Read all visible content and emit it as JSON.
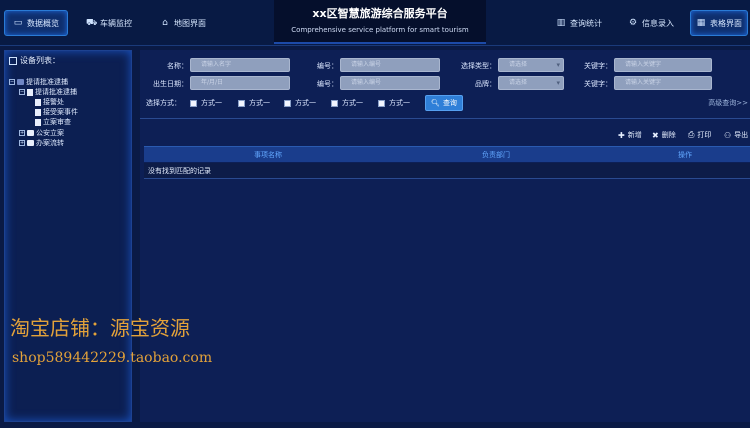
{
  "header": {
    "title": "xx区智慧旅游综合服务平台",
    "subtitle": "Comprehensive service platform for smart tourism",
    "nav_left": [
      {
        "label": "数据概览",
        "icon": "monitor-icon",
        "active": true
      },
      {
        "label": "车辆监控",
        "icon": "truck-icon",
        "active": false
      },
      {
        "label": "地图界面",
        "icon": "home-icon",
        "active": false
      }
    ],
    "nav_right": [
      {
        "label": "查询统计",
        "icon": "bar-chart-icon",
        "active": false
      },
      {
        "label": "信息录入",
        "icon": "gear-icon",
        "active": false
      },
      {
        "label": "表格界面",
        "icon": "table-icon",
        "active": true
      }
    ]
  },
  "sidebar": {
    "title": "设备列表：",
    "tree": [
      {
        "label": "提请批准逮捕",
        "level": 0,
        "toggle": "−"
      },
      {
        "label": "提请批准逮捕",
        "level": 1,
        "toggle": "−"
      },
      {
        "label": "接警处",
        "level": 2,
        "toggle": ""
      },
      {
        "label": "接受案事件",
        "level": 2,
        "toggle": ""
      },
      {
        "label": "立案审查",
        "level": 2,
        "toggle": ""
      },
      {
        "label": "公安立案",
        "level": 1,
        "toggle": "+"
      },
      {
        "label": "办案流转",
        "level": 1,
        "toggle": "+"
      }
    ]
  },
  "form": {
    "row1": [
      {
        "label": "名称：",
        "placeholder": "请输入名字",
        "type": "text"
      },
      {
        "label": "编号：",
        "placeholder": "请输入编号",
        "type": "text"
      },
      {
        "label": "选择类型：",
        "placeholder": "请选择",
        "type": "select"
      },
      {
        "label": "关键字：",
        "placeholder": "请输入关键字",
        "type": "text"
      }
    ],
    "row2": [
      {
        "label": "出生日期：",
        "placeholder": "年/月/日",
        "type": "text"
      },
      {
        "label": "编号：",
        "placeholder": "请输入编号",
        "type": "text"
      },
      {
        "label": "品牌：",
        "placeholder": "请选择",
        "type": "select"
      },
      {
        "label": "关键字：",
        "placeholder": "请输入关键字",
        "type": "text"
      }
    ],
    "choose_label": "选择方式：",
    "checkboxes": [
      "方式一",
      "方式一",
      "方式一",
      "方式一",
      "方式一"
    ],
    "search_label": "查询",
    "advanced_label": "高级查询>>"
  },
  "toolbar": {
    "add": "新增",
    "delete": "删除",
    "print": "打印",
    "export": "导出"
  },
  "table": {
    "columns": [
      "事项名称",
      "负责部门",
      "操作"
    ],
    "empty_text": "没有找到匹配的记录"
  },
  "watermark": {
    "line1": "淘宝店铺：源宝资源",
    "line2": "shop589442229.taobao.com"
  },
  "colors": {
    "background": "#0a1a45",
    "accent": "#2f7fd8",
    "header_text": "#63a8ff",
    "watermark": "#e3a23a"
  }
}
